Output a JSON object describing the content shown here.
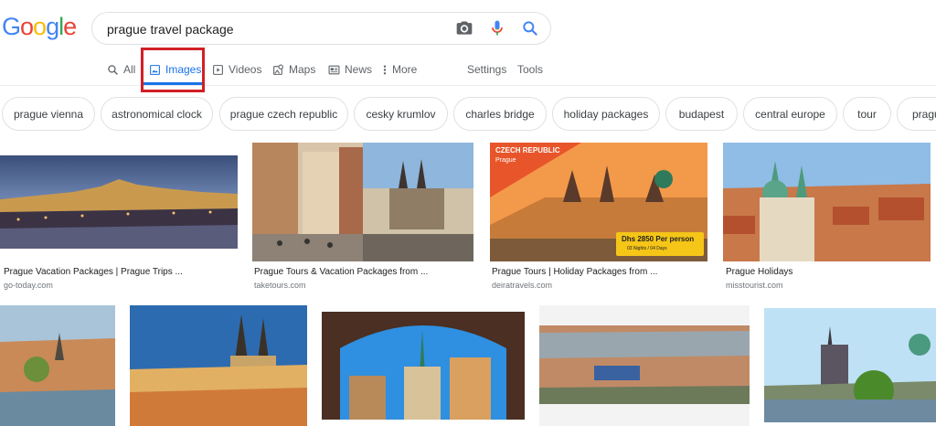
{
  "logo": {
    "letters": [
      "G",
      "o",
      "o",
      "g",
      "l",
      "e"
    ],
    "colors": [
      "#4285F4",
      "#EA4335",
      "#FBBC05",
      "#4285F4",
      "#34A853",
      "#EA4335"
    ]
  },
  "search": {
    "query": "prague travel package"
  },
  "tabs": [
    {
      "label": "All",
      "icon": "search-icon"
    },
    {
      "label": "Images",
      "icon": "image-icon",
      "active": true
    },
    {
      "label": "Videos",
      "icon": "play-icon"
    },
    {
      "label": "Maps",
      "icon": "map-icon"
    },
    {
      "label": "News",
      "icon": "news-icon"
    },
    {
      "label": "More",
      "icon": "more-vert-icon"
    },
    {
      "label": "Settings"
    },
    {
      "label": "Tools"
    }
  ],
  "chips": [
    "prague vienna",
    "astronomical clock",
    "prague czech republic",
    "cesky krumlov",
    "charles bridge",
    "holiday packages",
    "budapest",
    "central europe",
    "tour",
    "pragu"
  ],
  "results": [
    {
      "title": "Prague Vacation Packages | Prague Trips ...",
      "source": "go-today.com"
    },
    {
      "title": "Prague Tours & Vacation Packages from ...",
      "source": "taketours.com"
    },
    {
      "title": "Prague Tours | Holiday Packages from ...",
      "source": "deiratravels.com",
      "overlay": {
        "country": "CZECH REPUBLIC",
        "city": "Prague",
        "price": "Dhs 2850 Per person",
        "nights": "03 Nights / 04 Days"
      }
    },
    {
      "title": "Prague Holidays",
      "source": "misstourist.com"
    }
  ],
  "accent": "#1a73e8",
  "highlight_color": "#d21f26"
}
